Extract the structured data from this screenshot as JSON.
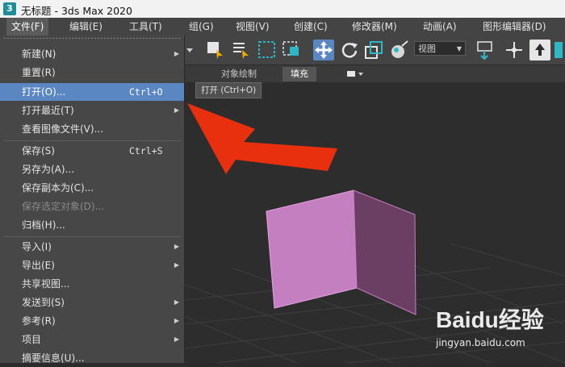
{
  "window": {
    "title": "无标题 - 3ds Max 2020",
    "app_icon_glyph": "3"
  },
  "menubar": [
    "文件(F)",
    "编辑(E)",
    "工具(T)",
    "组(G)",
    "视图(V)",
    "创建(C)",
    "修改器(M)",
    "动画(A)",
    "图形编辑器(D)"
  ],
  "toolbar": {
    "view_select": "视图"
  },
  "subbar": {
    "tab1": "对象绘制",
    "tab2": "填充"
  },
  "tooltip": "打开 (Ctrl+O)",
  "file_menu": {
    "items": [
      {
        "label": "新建(N)",
        "submenu": true
      },
      {
        "label": "重置(R)"
      },
      {
        "label": "打开(O)...",
        "shortcut": "Ctrl+O",
        "selected": true
      },
      {
        "label": "打开最近(T)",
        "submenu": true
      },
      {
        "label": "查看图像文件(V)..."
      },
      {
        "label": "保存(S)",
        "shortcut": "Ctrl+S"
      },
      {
        "label": "另存为(A)..."
      },
      {
        "label": "保存副本为(C)..."
      },
      {
        "label": "保存选定对象(D)...",
        "disabled": true
      },
      {
        "label": "归档(H)..."
      },
      {
        "label": "导入(I)",
        "submenu": true
      },
      {
        "label": "导出(E)",
        "submenu": true
      },
      {
        "label": "共享视图..."
      },
      {
        "label": "发送到(S)",
        "submenu": true
      },
      {
        "label": "参考(R)",
        "submenu": true
      },
      {
        "label": "项目",
        "submenu": true
      },
      {
        "label": "摘要信息(U)..."
      }
    ]
  },
  "icons": {
    "submenu": "triangle-right-icon",
    "dropdown": "chevron-down-icon"
  },
  "colors": {
    "selection": "#5a86c2",
    "arrow": "#e8300e",
    "wall": "#c47fc0"
  },
  "watermark": {
    "brand": "Baidu经验",
    "url": "jingyan.baidu.com"
  }
}
